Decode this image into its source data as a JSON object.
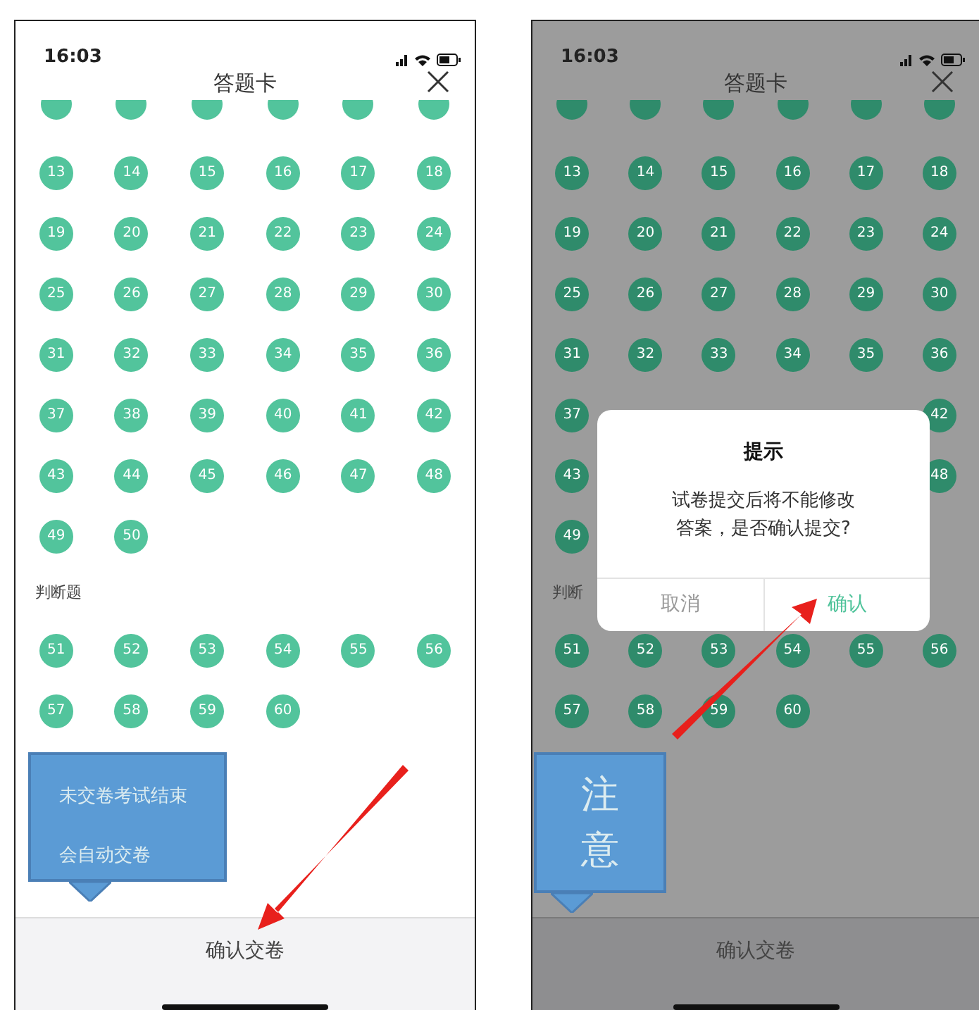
{
  "screens": [
    {
      "dimmed": false,
      "status_time": "16:03",
      "title": "答题卡",
      "sections": [
        {
          "questions": [
            {
              "kind": "number",
              "label": "13"
            },
            {
              "kind": "number",
              "label": "14"
            },
            {
              "kind": "number",
              "label": "15"
            },
            {
              "kind": "number",
              "label": "16"
            },
            {
              "kind": "number",
              "label": "17"
            },
            {
              "kind": "number",
              "label": "18"
            },
            {
              "kind": "number",
              "label": "19"
            },
            {
              "kind": "number",
              "label": "20"
            },
            {
              "kind": "number",
              "label": "21"
            },
            {
              "kind": "number",
              "label": "22"
            },
            {
              "kind": "number",
              "label": "23"
            },
            {
              "kind": "number",
              "label": "24"
            },
            {
              "kind": "number",
              "label": "25"
            },
            {
              "kind": "number",
              "label": "26"
            },
            {
              "kind": "number",
              "label": "27"
            },
            {
              "kind": "number",
              "label": "28"
            },
            {
              "kind": "number",
              "label": "29"
            },
            {
              "kind": "number",
              "label": "30"
            },
            {
              "kind": "number",
              "label": "31"
            },
            {
              "kind": "number",
              "label": "32"
            },
            {
              "kind": "number",
              "label": "33"
            },
            {
              "kind": "number",
              "label": "34"
            },
            {
              "kind": "number",
              "label": "35"
            },
            {
              "kind": "number",
              "label": "36"
            },
            {
              "kind": "number",
              "label": "37"
            },
            {
              "kind": "number",
              "label": "38"
            },
            {
              "kind": "number",
              "label": "39"
            },
            {
              "kind": "number",
              "label": "40"
            },
            {
              "kind": "number",
              "label": "41"
            },
            {
              "kind": "number",
              "label": "42"
            },
            {
              "kind": "number",
              "label": "43"
            },
            {
              "kind": "number",
              "label": "44"
            },
            {
              "kind": "number",
              "label": "45"
            },
            {
              "kind": "number",
              "label": "46"
            },
            {
              "kind": "number",
              "label": "47"
            },
            {
              "kind": "number",
              "label": "48"
            },
            {
              "kind": "number",
              "label": "49"
            },
            {
              "kind": "number",
              "label": "50"
            }
          ]
        },
        {
          "heading": "判断题",
          "questions": [
            {
              "kind": "number",
              "label": "51"
            },
            {
              "kind": "number",
              "label": "52"
            },
            {
              "kind": "number",
              "label": "53"
            },
            {
              "kind": "number",
              "label": "54"
            },
            {
              "kind": "number",
              "label": "55"
            },
            {
              "kind": "number",
              "label": "56"
            },
            {
              "kind": "number",
              "label": "57"
            },
            {
              "kind": "number",
              "label": "58"
            },
            {
              "kind": "number",
              "label": "59"
            },
            {
              "kind": "number",
              "label": "60"
            }
          ]
        }
      ],
      "callout": {
        "kind": "lines",
        "texts": [
          "未交卷考试结束",
          "会自动交卷"
        ]
      },
      "submit_button": "确认交卷"
    },
    {
      "dimmed": true,
      "status_time": "16:03",
      "title": "答题卡",
      "sections": [
        {
          "questions": [
            {
              "kind": "number",
              "label": "13"
            },
            {
              "kind": "number",
              "label": "14"
            },
            {
              "kind": "number",
              "label": "15"
            },
            {
              "kind": "number",
              "label": "16"
            },
            {
              "kind": "number",
              "label": "17"
            },
            {
              "kind": "number",
              "label": "18"
            },
            {
              "kind": "number",
              "label": "19"
            },
            {
              "kind": "number",
              "label": "20"
            },
            {
              "kind": "number",
              "label": "21"
            },
            {
              "kind": "number",
              "label": "22"
            },
            {
              "kind": "number",
              "label": "23"
            },
            {
              "kind": "number",
              "label": "24"
            },
            {
              "kind": "number",
              "label": "25"
            },
            {
              "kind": "number",
              "label": "26"
            },
            {
              "kind": "number",
              "label": "27"
            },
            {
              "kind": "number",
              "label": "28"
            },
            {
              "kind": "number",
              "label": "29"
            },
            {
              "kind": "number",
              "label": "30"
            },
            {
              "kind": "number",
              "label": "31"
            },
            {
              "kind": "number",
              "label": "32"
            },
            {
              "kind": "number",
              "label": "33"
            },
            {
              "kind": "number",
              "label": "34"
            },
            {
              "kind": "number",
              "label": "35"
            },
            {
              "kind": "number",
              "label": "36"
            },
            {
              "kind": "number",
              "label": "37"
            },
            {
              "kind": "covered"
            },
            {
              "kind": "covered"
            },
            {
              "kind": "covered"
            },
            {
              "kind": "covered"
            },
            {
              "kind": "number",
              "label": "42"
            },
            {
              "kind": "number",
              "label": "43"
            },
            {
              "kind": "covered"
            },
            {
              "kind": "covered"
            },
            {
              "kind": "covered"
            },
            {
              "kind": "covered"
            },
            {
              "kind": "number",
              "label": "48"
            },
            {
              "kind": "number",
              "label": "49"
            },
            {
              "kind": "covered"
            }
          ]
        },
        {
          "heading": "判断",
          "questions": [
            {
              "kind": "number",
              "label": "51"
            },
            {
              "kind": "number",
              "label": "52"
            },
            {
              "kind": "number",
              "label": "53"
            },
            {
              "kind": "number",
              "label": "54"
            },
            {
              "kind": "number",
              "label": "55"
            },
            {
              "kind": "number",
              "label": "56"
            },
            {
              "kind": "number",
              "label": "57"
            },
            {
              "kind": "number",
              "label": "58"
            },
            {
              "kind": "number",
              "label": "59"
            },
            {
              "kind": "number",
              "label": "60"
            }
          ]
        }
      ],
      "dialog": {
        "title": "提示",
        "message": "试卷提交后将不能修改答案，是否确认提交?",
        "buttons": [
          {
            "label": "取消",
            "primary": false
          },
          {
            "label": "确认",
            "primary": true
          }
        ]
      },
      "callout": {
        "kind": "vertical",
        "texts": [
          "注意"
        ]
      },
      "submit_button": "确认交卷"
    }
  ]
}
